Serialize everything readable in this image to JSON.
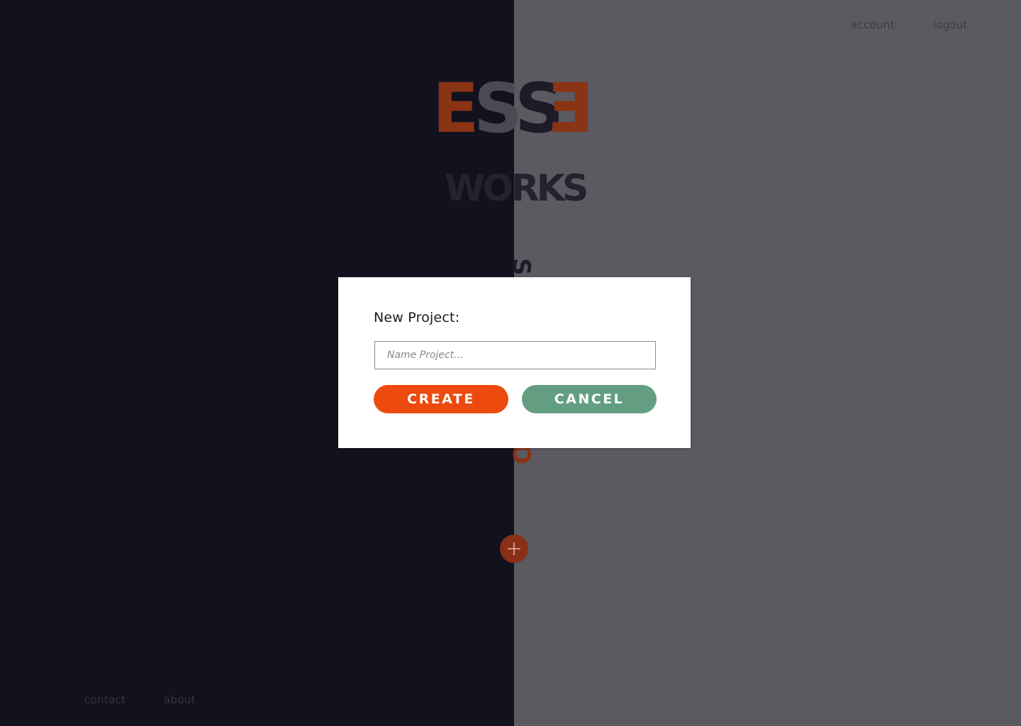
{
  "header": {
    "account_label": "account",
    "logout_label": "logout"
  },
  "footer": {
    "contact_label": "contact",
    "about_label": "about"
  },
  "logo": {
    "letters": [
      "E",
      "S",
      "S",
      "E"
    ],
    "brand_color": "#8a3315"
  },
  "hero": {
    "title": "WORKS"
  },
  "add_button": {
    "icon": "plus-icon"
  },
  "modal": {
    "title": "New Project:",
    "input": {
      "placeholder": "Name Project...",
      "value": ""
    },
    "create_label": "CREATE",
    "cancel_label": "CANCEL"
  },
  "colors": {
    "left_panel": "#12121f",
    "right_panel": "#5b5a60",
    "accent_orange": "#ec4a0e",
    "accent_green": "#639e82"
  }
}
